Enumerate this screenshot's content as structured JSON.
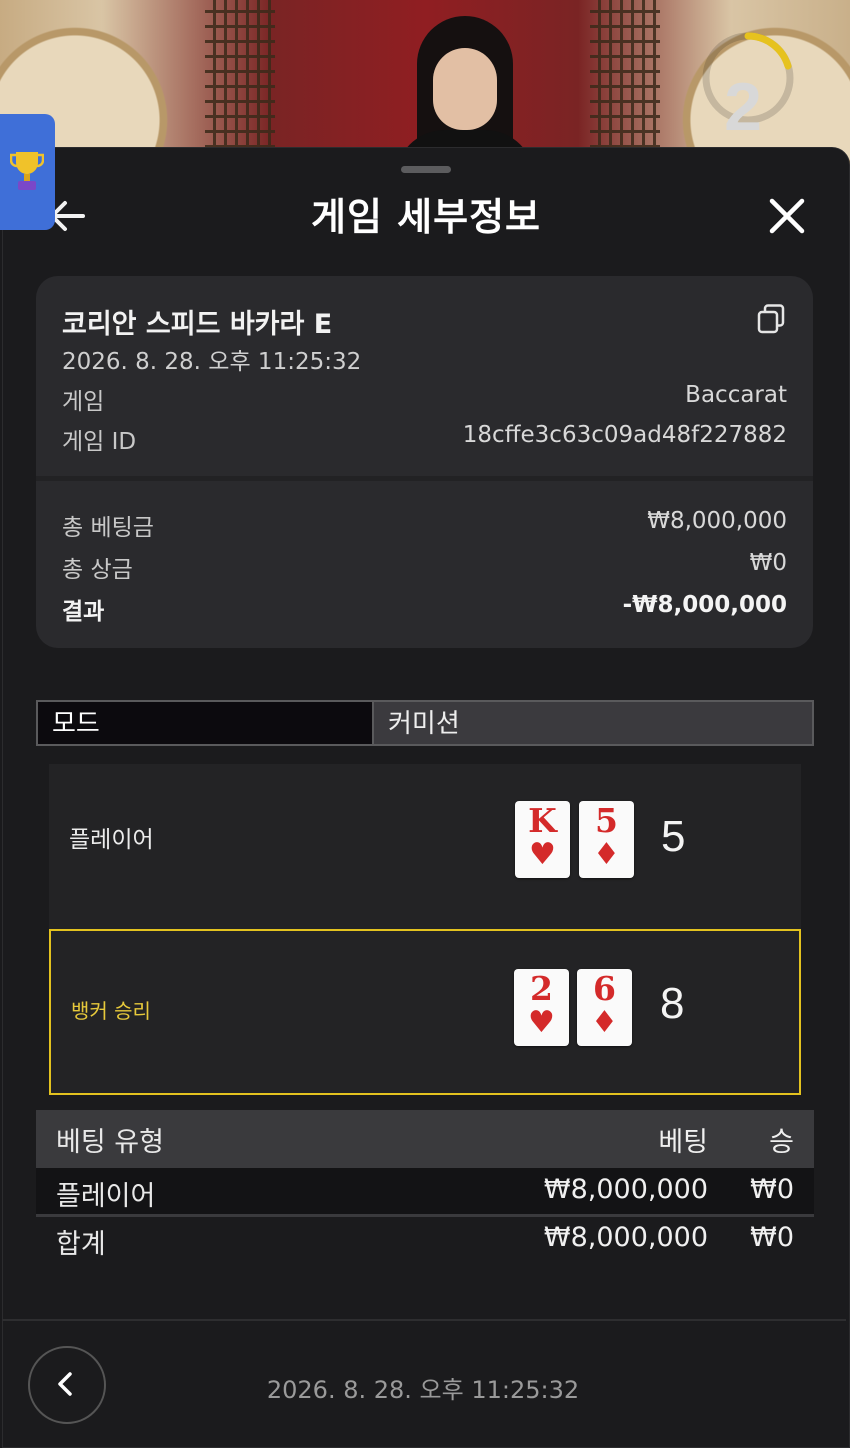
{
  "video": {
    "countdown": "2"
  },
  "header": {
    "title": "게임 세부정보"
  },
  "details": {
    "game_name": "코리안 스피드 바카라 E",
    "datetime": "2026. 8. 28. 오후 11:25:32",
    "game_label": "게임",
    "game_value": "Baccarat",
    "game_id_label": "게임 ID",
    "game_id_value": "18cffe3c63c09ad48f227882"
  },
  "summary": {
    "total_bet_label": "총 베팅금",
    "total_bet_value": "₩8,000,000",
    "total_win_label": "총 상금",
    "total_win_value": "₩0",
    "result_label": "결과",
    "result_value": "-₩8,000,000"
  },
  "tabs": {
    "mode": "모드",
    "commission": "커미션"
  },
  "hands": {
    "player": {
      "label": "플레이어",
      "cards": [
        {
          "rank": "K",
          "suit": "♥"
        },
        {
          "rank": "5",
          "suit": "♦"
        }
      ],
      "score": "5"
    },
    "banker": {
      "label": "뱅커 승리",
      "cards": [
        {
          "rank": "2",
          "suit": "♥"
        },
        {
          "rank": "6",
          "suit": "♦"
        }
      ],
      "score": "8"
    },
    "winner_color": "#e3c21f"
  },
  "bet_table": {
    "headers": {
      "type": "베팅 유형",
      "bet": "베팅",
      "win": "승"
    },
    "rows": [
      {
        "type": "플레이어",
        "bet": "₩8,000,000",
        "win": "₩0"
      }
    ],
    "total": {
      "type": "합계",
      "bet": "₩8,000,000",
      "win": "₩0"
    }
  },
  "footer": {
    "datetime": "2026. 8. 28. 오후 11:25:32"
  }
}
